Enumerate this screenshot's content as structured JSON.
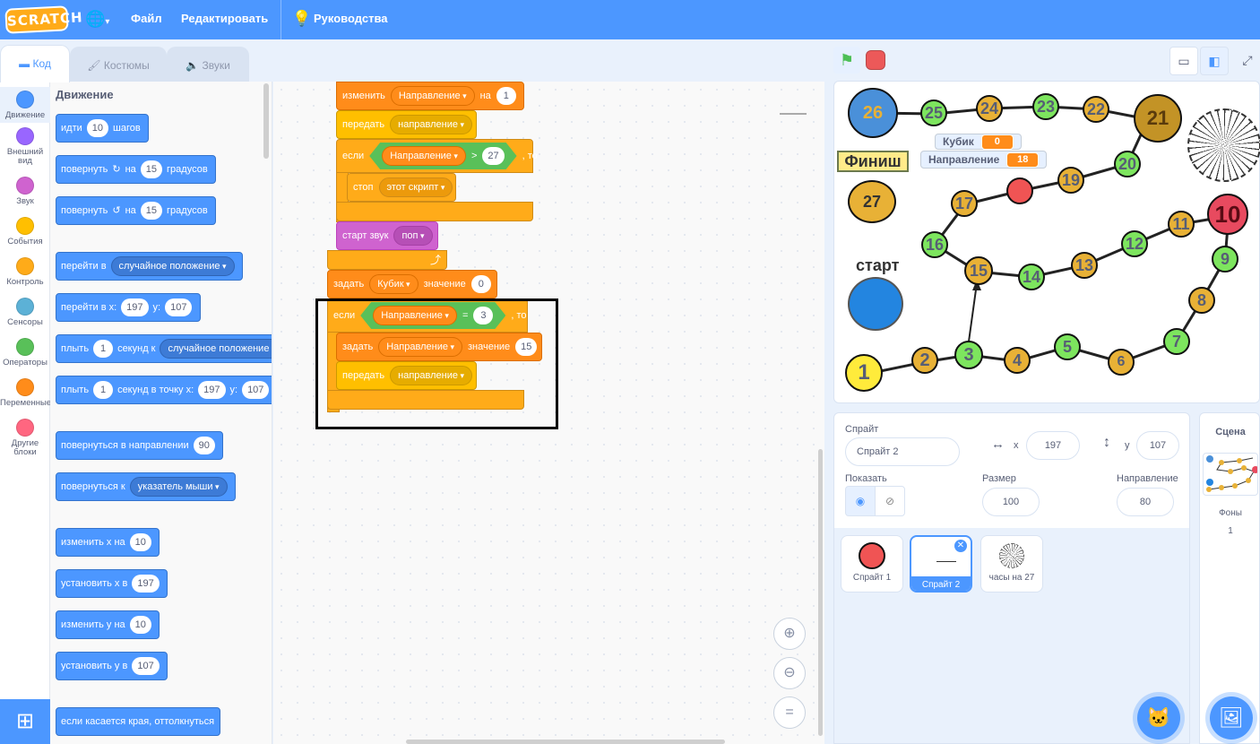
{
  "menu": {
    "logo": "SCRATCH",
    "file": "Файл",
    "edit": "Редактировать",
    "tutorials": "Руководства"
  },
  "tabs": {
    "code": "Код",
    "costumes": "Костюмы",
    "sounds": "Звуки"
  },
  "categories": [
    {
      "label": "Движение",
      "color": "#4c97ff"
    },
    {
      "label": "Внешний вид",
      "color": "#9966ff"
    },
    {
      "label": "Звук",
      "color": "#cf63cf"
    },
    {
      "label": "События",
      "color": "#ffbf00"
    },
    {
      "label": "Контроль",
      "color": "#ffab19"
    },
    {
      "label": "Сенсоры",
      "color": "#5cb1d6"
    },
    {
      "label": "Операторы",
      "color": "#59c059"
    },
    {
      "label": "Переменные",
      "color": "#ff8c1a"
    },
    {
      "label": "Другие блоки",
      "color": "#ff6680"
    }
  ],
  "palette": {
    "title": "Движение",
    "move": {
      "a": "идти",
      "n": "10",
      "b": "шагов"
    },
    "turn_right": {
      "a": "повернуть",
      "icon": "↻",
      "b": "на",
      "n": "15",
      "c": "градусов"
    },
    "turn_left": {
      "a": "повернуть",
      "icon": "↺",
      "b": "на",
      "n": "15",
      "c": "градусов"
    },
    "goto": {
      "a": "перейти в",
      "dd": "случайное положение"
    },
    "goto_xy": {
      "a": "перейти в x:",
      "x": "197",
      "b": "y:",
      "y": "107"
    },
    "glide": {
      "a": "плыть",
      "n": "1",
      "b": "секунд к",
      "dd": "случайное положение"
    },
    "glide_xy": {
      "a": "плыть",
      "n": "1",
      "b": "секунд в точку x:",
      "x": "197",
      "c": "y:",
      "y": "107"
    },
    "point_dir": {
      "a": "повернуться в направлении",
      "n": "90"
    },
    "point_towards": {
      "a": "повернуться к",
      "dd": "указатель мыши"
    },
    "change_x": {
      "a": "изменить х на",
      "n": "10"
    },
    "set_x": {
      "a": "установить х в",
      "n": "197"
    },
    "change_y": {
      "a": "изменить у на",
      "n": "10"
    },
    "set_y": {
      "a": "установить у в",
      "n": "107"
    },
    "bounce": "если касается края, оттолкнуться"
  },
  "script": {
    "change": {
      "a": "изменить",
      "var": "Направление",
      "b": "на",
      "n": "1"
    },
    "broadcast1": {
      "a": "передать",
      "msg": "направление"
    },
    "if1": {
      "a": "если",
      "var": "Направление",
      "op": ">",
      "n": "27",
      "then": ", то"
    },
    "stop": {
      "a": "стоп",
      "dd": "этот скрипт"
    },
    "sound": {
      "a": "старт звук",
      "dd": "поп"
    },
    "set1": {
      "a": "задать",
      "var": "Кубик",
      "b": "значение",
      "n": "0"
    },
    "if2": {
      "a": "если",
      "var": "Направление",
      "op": "=",
      "n": "3",
      "then": ", то"
    },
    "set2": {
      "a": "задать",
      "var": "Направление",
      "b": "значение",
      "n": "15"
    },
    "broadcast2": {
      "a": "передать",
      "msg": "направление"
    }
  },
  "stage": {
    "monitors": [
      {
        "label": "Кубик",
        "value": "0"
      },
      {
        "label": "Направление",
        "value": "18"
      }
    ],
    "finish": "Финиш",
    "start": "старт",
    "cells": [
      "1",
      "2",
      "3",
      "4",
      "5",
      "6",
      "7",
      "8",
      "9",
      "10",
      "11",
      "12",
      "13",
      "14",
      "15",
      "16",
      "17",
      "19",
      "20",
      "21",
      "22",
      "23",
      "24",
      "25",
      "26",
      "27"
    ]
  },
  "sprite_info": {
    "sprite_label": "Спрайт",
    "sprite_name": "Спрайт 2",
    "x_label": "x",
    "x": "197",
    "y_label": "y",
    "y": "107",
    "show_label": "Показать",
    "size_label": "Размер",
    "size": "100",
    "direction_label": "Направление",
    "direction": "80"
  },
  "sprites": [
    {
      "name": "Спрайт 1"
    },
    {
      "name": "Спрайт 2"
    },
    {
      "name": "часы на 27"
    }
  ],
  "stage_panel": {
    "title": "Сцена",
    "backdrops_label": "Фоны",
    "backdrops_count": "1"
  }
}
